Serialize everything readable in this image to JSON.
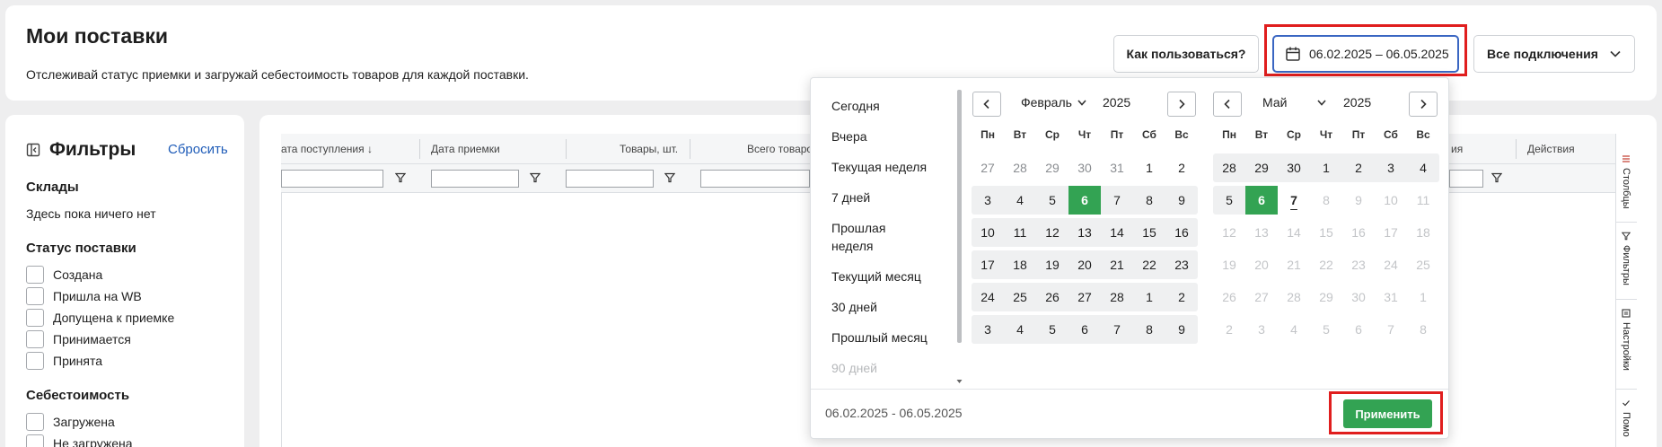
{
  "header": {
    "title": "Мои поставки",
    "subtitle": "Отслеживай статус приемки и загружай себестоимость товаров для каждой поставки.",
    "howto_label": "Как пользоваться?",
    "date_range_label": "06.02.2025 – 06.05.2025",
    "connections_label": "Все подключения"
  },
  "filters": {
    "title": "Фильтры",
    "reset_label": "Сбросить",
    "warehouses_title": "Склады",
    "warehouses_empty": "Здесь пока ничего нет",
    "status_title": "Статус поставки",
    "status_items": [
      "Создана",
      "Пришла на WB",
      "Допущена к приемке",
      "Принимается",
      "Принята"
    ],
    "cost_title": "Себестоимость",
    "cost_items": [
      "Загружена",
      "Не загружена"
    ]
  },
  "table": {
    "columns": [
      "ата поступления",
      "Дата приемки",
      "Товары, шт.",
      "Всего товаро",
      "ия",
      "Действия"
    ],
    "sort_indicator": "↓"
  },
  "side_tabs": [
    "Столбцы",
    "Фильтры",
    "Настройки",
    "Помо"
  ],
  "datepicker": {
    "presets": [
      "Сегодня",
      "Вчера",
      "Текущая неделя",
      "7 дней",
      "Прошлая\nнеделя",
      "Текущий месяц",
      "30 дней",
      "Прошлый месяц",
      "90 дней"
    ],
    "weekdays": [
      "Пн",
      "Вт",
      "Ср",
      "Чт",
      "Пт",
      "Сб",
      "Вс"
    ],
    "left_month": {
      "month": "Февраль",
      "year": "2025",
      "weeks": [
        [
          "27",
          "28",
          "29",
          "30",
          "31",
          "1",
          "2"
        ],
        [
          "3",
          "4",
          "5",
          "6",
          "7",
          "8",
          "9"
        ],
        [
          "10",
          "11",
          "12",
          "13",
          "14",
          "15",
          "16"
        ],
        [
          "17",
          "18",
          "19",
          "20",
          "21",
          "22",
          "23"
        ],
        [
          "24",
          "25",
          "26",
          "27",
          "28",
          "1",
          "2"
        ],
        [
          "3",
          "4",
          "5",
          "6",
          "7",
          "8",
          "9"
        ]
      ]
    },
    "right_month": {
      "month": "Май",
      "year": "2025",
      "weeks": [
        [
          "28",
          "29",
          "30",
          "1",
          "2",
          "3",
          "4"
        ],
        [
          "5",
          "6",
          "7",
          "8",
          "9",
          "10",
          "11"
        ],
        [
          "12",
          "13",
          "14",
          "15",
          "16",
          "17",
          "18"
        ],
        [
          "19",
          "20",
          "21",
          "22",
          "23",
          "24",
          "25"
        ],
        [
          "26",
          "27",
          "28",
          "29",
          "30",
          "31",
          "1"
        ],
        [
          "2",
          "3",
          "4",
          "5",
          "6",
          "7",
          "8"
        ]
      ]
    },
    "selected_range_text": "06.02.2025 - 06.05.2025",
    "apply_label": "Применить"
  },
  "colors": {
    "accent_green": "#33a353",
    "highlight_red": "#e01e1e",
    "link_blue": "#1f5cb8",
    "focus_blue": "#3a66c2"
  }
}
